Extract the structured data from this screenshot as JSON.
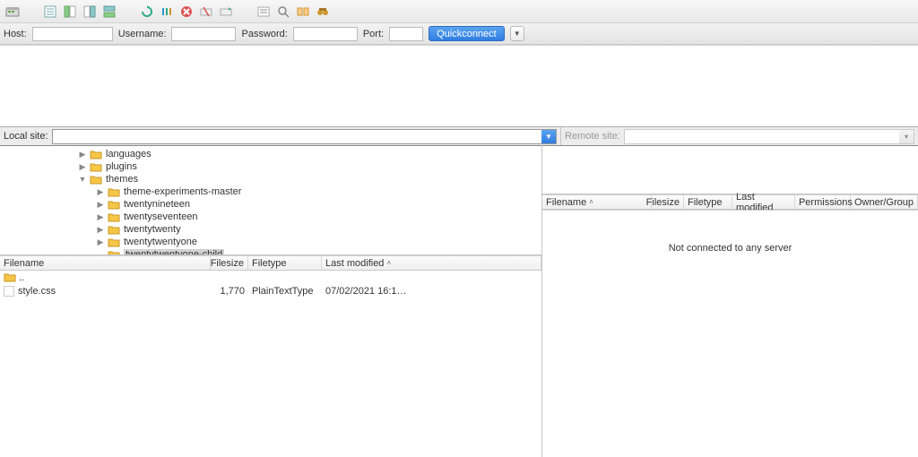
{
  "quickconnect": {
    "host_label": "Host:",
    "username_label": "Username:",
    "password_label": "Password:",
    "port_label": "Port:",
    "button": "Quickconnect"
  },
  "local": {
    "label": "Local site:",
    "tree": [
      {
        "indent": 88,
        "disclosure": "right",
        "name": "languages"
      },
      {
        "indent": 88,
        "disclosure": "right",
        "name": "plugins"
      },
      {
        "indent": 88,
        "disclosure": "down",
        "name": "themes"
      },
      {
        "indent": 108,
        "disclosure": "right",
        "name": "theme-experiments-master"
      },
      {
        "indent": 108,
        "disclosure": "right",
        "name": "twentynineteen"
      },
      {
        "indent": 108,
        "disclosure": "right",
        "name": "twentyseventeen"
      },
      {
        "indent": 108,
        "disclosure": "right",
        "name": "twentytwenty"
      },
      {
        "indent": 108,
        "disclosure": "right",
        "name": "twentytwentyone"
      },
      {
        "indent": 108,
        "disclosure": "none",
        "name": "twentytwentyone-child",
        "selected": true
      }
    ],
    "columns": {
      "filename": "Filename",
      "filesize": "Filesize",
      "filetype": "Filetype",
      "lastmod": "Last modified"
    },
    "files": [
      {
        "name": "..",
        "is_parent": true
      },
      {
        "name": "style.css",
        "size": "1,770",
        "type": "PlainTextType",
        "modified": "07/02/2021 16:1…"
      }
    ]
  },
  "remote": {
    "label": "Remote site:",
    "columns": {
      "filename": "Filename",
      "filesize": "Filesize",
      "filetype": "Filetype",
      "lastmod": "Last modified",
      "permissions": "Permissions",
      "owner": "Owner/Group"
    },
    "empty_message": "Not connected to any server"
  }
}
